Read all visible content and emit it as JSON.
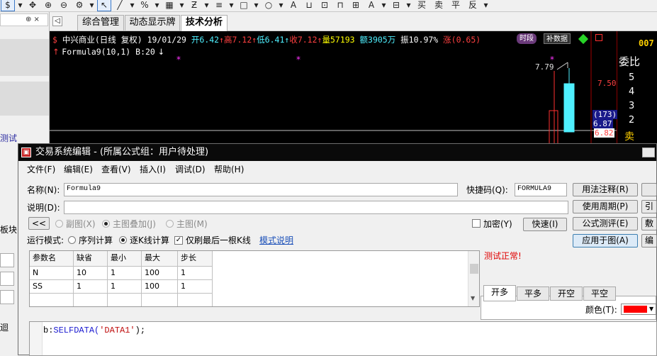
{
  "toolbar": {
    "items": [
      "$",
      "▾",
      "✥",
      "⊕",
      "⊖",
      "⚙",
      "▾",
      "↖",
      "╱",
      "▾",
      "%",
      "▾",
      "▦",
      "▾",
      "Ƶ",
      "▾",
      "≡",
      "▾",
      "□",
      "▾",
      "○",
      "▾",
      "A",
      "⊔",
      "⊡",
      "⊓",
      "⊞",
      "A",
      "▾",
      "⊟",
      "▾",
      "买",
      "卖",
      "平",
      "反",
      "▾"
    ]
  },
  "left_panel": {
    "pin": "⊕ ×",
    "item1": "测试",
    "item2": "板块",
    "item3": "迴"
  },
  "tabs": [
    {
      "label": "综合管理"
    },
    {
      "label": "动态显示牌"
    },
    {
      "label": "技术分析"
    }
  ],
  "chart": {
    "stock": "中兴商业(日线 复权)",
    "date": "19/01/29",
    "open": "开6.42",
    "high": "高7.12",
    "low": "低6.41",
    "close": "收7.12",
    "volume": "量57193",
    "amount": "额3905万",
    "amplitude": "振10.97%",
    "change": "涨(0.65)",
    "time_button": "时段",
    "supplement_button": "补数据",
    "formula_line": "Formula9(10,1) B:20",
    "peak_label": "7.79",
    "axis_750": "7.50",
    "axis_173": "(173)",
    "axis_687": "6.87",
    "axis_682": "6.82",
    "corner_code": "007",
    "wei_bi": "委比",
    "levels": [
      "5",
      "4",
      "3",
      "2"
    ],
    "sell": "卖"
  },
  "dialog": {
    "title": "交易系统编辑 - (所属公式组：用户待处理)",
    "menus": [
      "文件(F)",
      "编辑(E)",
      "查看(V)",
      "插入(I)",
      "调试(D)",
      "帮助(H)"
    ],
    "name_label": "名称(N):",
    "name_value": "Formula9",
    "shortcut_label": "快捷码(Q):",
    "shortcut_value": "FORMULA9",
    "desc_label": "说明(D):",
    "desc_value": "",
    "back_btn": "<<",
    "sub_chart": "副图(X)",
    "main_overlay": "主图叠加(J)",
    "main_chart": "主图(M)",
    "encrypt": "加密(Y)",
    "fast_btn": "快速(I)",
    "run_mode_label": "运行模式:",
    "seq_calc": "序列计算",
    "kline_calc": "逐K线计算",
    "last_kline": "仅刷最后一根K线",
    "mode_doc": "模式说明",
    "test_status": "测试正常!",
    "right_buttons": [
      "用法注释(R)",
      "使用周期(P)",
      "公式测评(E)",
      "应用于图(A)"
    ],
    "edge_buttons": [
      "",
      "引",
      "敷",
      "编"
    ],
    "param_headers": [
      "参数名",
      "缺省",
      "最小",
      "最大",
      "步长"
    ],
    "params": [
      [
        "N",
        "10",
        "1",
        "100",
        "1"
      ],
      [
        "SS",
        "1",
        "1",
        "100",
        "1"
      ]
    ],
    "signal_tabs": [
      "开多",
      "平多",
      "开空",
      "平空"
    ],
    "color_label": "颜色(T):",
    "signal_color": "#ff0000",
    "code_prefix": "b:",
    "code_func": "SELFDATA(",
    "code_arg": "'DATA1'",
    "code_suffix": ");"
  }
}
